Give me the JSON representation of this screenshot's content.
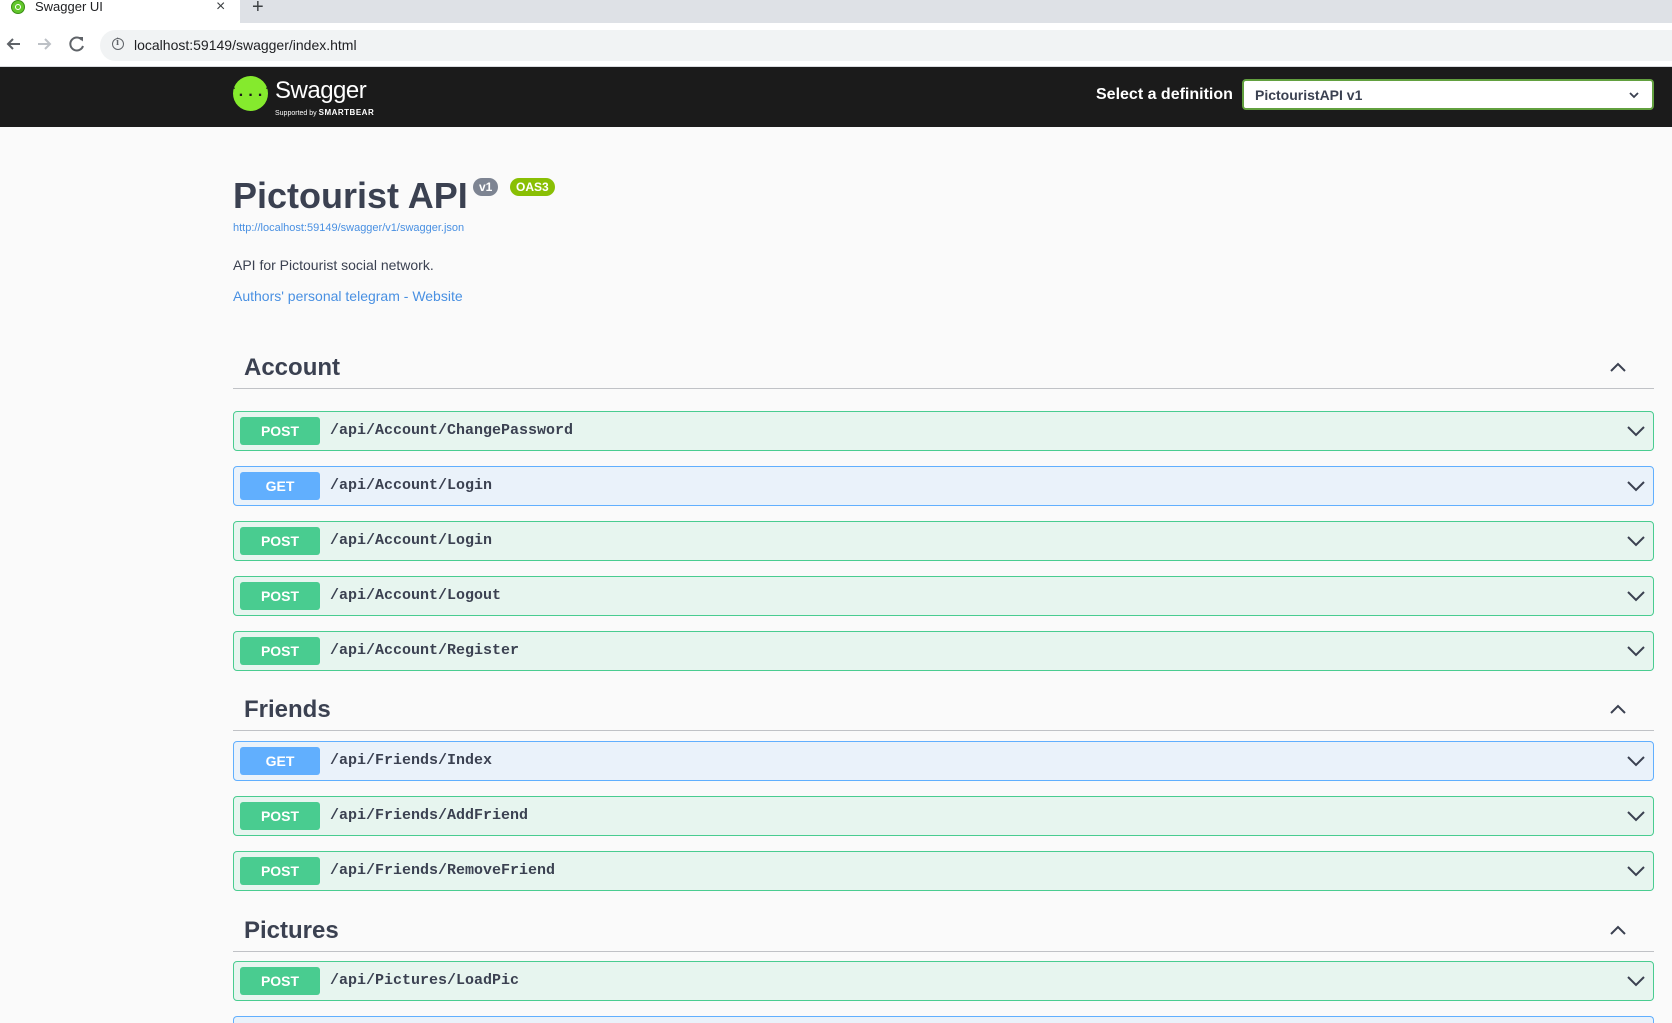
{
  "browser": {
    "tab_title": "Swagger UI",
    "close_glyph": "×",
    "new_tab_glyph": "+",
    "url": "localhost:59149/swagger/index.html"
  },
  "topbar": {
    "logo_text": "Swagger",
    "logo_sub_prefix": "Supported by",
    "logo_sub_brand": "SMARTBEAR",
    "definition_label": "Select a definition",
    "definition_value": "PictouristAPI v1"
  },
  "info": {
    "title": "Pictourist API",
    "version_badge": "v1",
    "oas_badge": "OAS3",
    "spec_url": "http://localhost:59149/swagger/v1/swagger.json",
    "description": "API for Pictourist social network.",
    "contact": "Authors' personal telegram - Website"
  },
  "tags": [
    {
      "name": "Account",
      "operations": [
        {
          "method": "POST",
          "path": "/api/Account/ChangePassword"
        },
        {
          "method": "GET",
          "path": "/api/Account/Login"
        },
        {
          "method": "POST",
          "path": "/api/Account/Login"
        },
        {
          "method": "POST",
          "path": "/api/Account/Logout"
        },
        {
          "method": "POST",
          "path": "/api/Account/Register"
        }
      ]
    },
    {
      "name": "Friends",
      "operations": [
        {
          "method": "GET",
          "path": "/api/Friends/Index"
        },
        {
          "method": "POST",
          "path": "/api/Friends/AddFriend"
        },
        {
          "method": "POST",
          "path": "/api/Friends/RemoveFriend"
        }
      ]
    },
    {
      "name": "Pictures",
      "operations": [
        {
          "method": "POST",
          "path": "/api/Pictures/LoadPic"
        }
      ]
    }
  ],
  "colors": {
    "post": "#49cc90",
    "get": "#61affe",
    "topbar": "#1b1b1b",
    "logo": "#85ea2d",
    "link": "#4990e2"
  }
}
